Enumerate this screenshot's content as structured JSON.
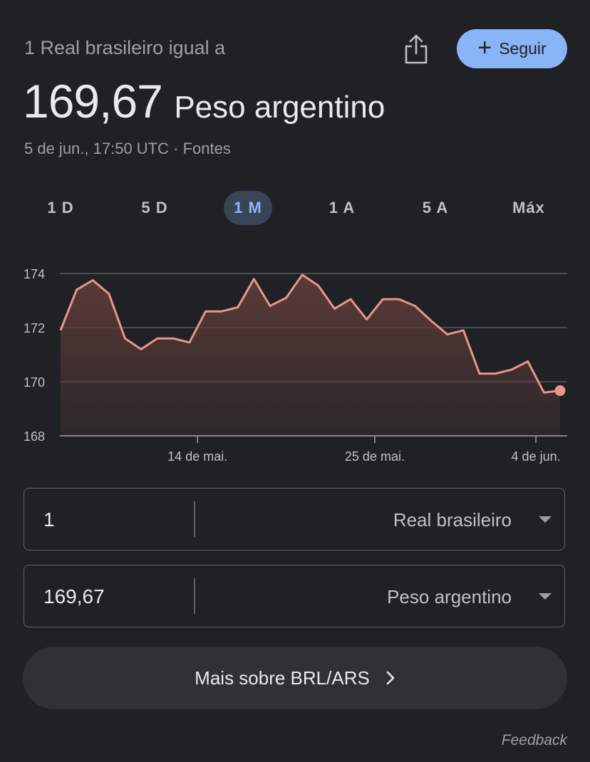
{
  "header": {
    "subtitle": "1 Real brasileiro igual a",
    "rate_value": "169,67",
    "rate_currency": "Peso argentino",
    "timestamp": "5 de jun., 17:50 UTC · ",
    "sources_label": "Fontes",
    "follow_label": "Seguir",
    "share_icon": "share-icon",
    "follow_icon": "plus-icon"
  },
  "ranges": [
    "1 D",
    "5 D",
    "1 M",
    "1 A",
    "5 A",
    "Máx"
  ],
  "active_range": "1 M",
  "colors": {
    "background": "#202124",
    "accent": "#8ab4f8",
    "line": "#e8958b",
    "fill": "#5a3b38"
  },
  "chart_data": {
    "type": "area",
    "y_ticks": [
      "174",
      "172",
      "170",
      "168"
    ],
    "ylim": [
      168,
      174
    ],
    "x_ticks": [
      {
        "label": "14 de mai.",
        "x": 7.5
      },
      {
        "label": "25 de mai.",
        "x": 18.5
      },
      {
        "label": "4 de jun.",
        "x": 28.5
      }
    ],
    "xlim": [
      -1,
      30
    ],
    "grid": true,
    "points": [
      {
        "x": -1,
        "y": 171.9
      },
      {
        "x": 0,
        "y": 173.4
      },
      {
        "x": 1,
        "y": 173.75
      },
      {
        "x": 2,
        "y": 173.25
      },
      {
        "x": 3,
        "y": 171.6
      },
      {
        "x": 4,
        "y": 171.2
      },
      {
        "x": 5,
        "y": 171.6
      },
      {
        "x": 6,
        "y": 171.6
      },
      {
        "x": 7,
        "y": 171.45
      },
      {
        "x": 8,
        "y": 172.6
      },
      {
        "x": 9,
        "y": 172.6
      },
      {
        "x": 10,
        "y": 172.75
      },
      {
        "x": 11,
        "y": 173.8
      },
      {
        "x": 12,
        "y": 172.8
      },
      {
        "x": 13,
        "y": 173.1
      },
      {
        "x": 14,
        "y": 173.95
      },
      {
        "x": 15,
        "y": 173.55
      },
      {
        "x": 16,
        "y": 172.7
      },
      {
        "x": 17,
        "y": 173.05
      },
      {
        "x": 18,
        "y": 172.3
      },
      {
        "x": 19,
        "y": 173.05
      },
      {
        "x": 20,
        "y": 173.05
      },
      {
        "x": 21,
        "y": 172.8
      },
      {
        "x": 22,
        "y": 172.25
      },
      {
        "x": 23,
        "y": 171.75
      },
      {
        "x": 24,
        "y": 171.9
      },
      {
        "x": 25,
        "y": 170.3
      },
      {
        "x": 26,
        "y": 170.3
      },
      {
        "x": 27,
        "y": 170.45
      },
      {
        "x": 28,
        "y": 170.75
      },
      {
        "x": 29,
        "y": 169.6
      },
      {
        "x": 30,
        "y": 169.67
      }
    ]
  },
  "converter": {
    "from_amount": "1",
    "from_currency": "Real brasileiro",
    "to_amount": "169,67",
    "to_currency": "Peso argentino"
  },
  "more_label": "Mais sobre BRL/ARS",
  "feedback_label": "Feedback"
}
